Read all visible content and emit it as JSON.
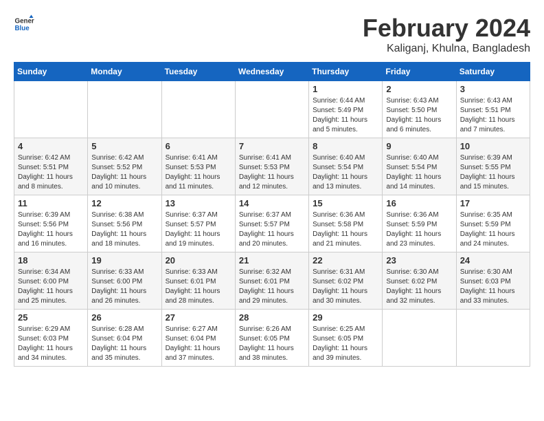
{
  "header": {
    "title": "February 2024",
    "location": "Kaliganj, Khulna, Bangladesh",
    "logo_general": "General",
    "logo_blue": "Blue"
  },
  "weekdays": [
    "Sunday",
    "Monday",
    "Tuesday",
    "Wednesday",
    "Thursday",
    "Friday",
    "Saturday"
  ],
  "weeks": [
    [
      {
        "day": "",
        "info": ""
      },
      {
        "day": "",
        "info": ""
      },
      {
        "day": "",
        "info": ""
      },
      {
        "day": "",
        "info": ""
      },
      {
        "day": "1",
        "info": "Sunrise: 6:44 AM\nSunset: 5:49 PM\nDaylight: 11 hours\nand 5 minutes."
      },
      {
        "day": "2",
        "info": "Sunrise: 6:43 AM\nSunset: 5:50 PM\nDaylight: 11 hours\nand 6 minutes."
      },
      {
        "day": "3",
        "info": "Sunrise: 6:43 AM\nSunset: 5:51 PM\nDaylight: 11 hours\nand 7 minutes."
      }
    ],
    [
      {
        "day": "4",
        "info": "Sunrise: 6:42 AM\nSunset: 5:51 PM\nDaylight: 11 hours\nand 8 minutes."
      },
      {
        "day": "5",
        "info": "Sunrise: 6:42 AM\nSunset: 5:52 PM\nDaylight: 11 hours\nand 10 minutes."
      },
      {
        "day": "6",
        "info": "Sunrise: 6:41 AM\nSunset: 5:53 PM\nDaylight: 11 hours\nand 11 minutes."
      },
      {
        "day": "7",
        "info": "Sunrise: 6:41 AM\nSunset: 5:53 PM\nDaylight: 11 hours\nand 12 minutes."
      },
      {
        "day": "8",
        "info": "Sunrise: 6:40 AM\nSunset: 5:54 PM\nDaylight: 11 hours\nand 13 minutes."
      },
      {
        "day": "9",
        "info": "Sunrise: 6:40 AM\nSunset: 5:54 PM\nDaylight: 11 hours\nand 14 minutes."
      },
      {
        "day": "10",
        "info": "Sunrise: 6:39 AM\nSunset: 5:55 PM\nDaylight: 11 hours\nand 15 minutes."
      }
    ],
    [
      {
        "day": "11",
        "info": "Sunrise: 6:39 AM\nSunset: 5:56 PM\nDaylight: 11 hours\nand 16 minutes."
      },
      {
        "day": "12",
        "info": "Sunrise: 6:38 AM\nSunset: 5:56 PM\nDaylight: 11 hours\nand 18 minutes."
      },
      {
        "day": "13",
        "info": "Sunrise: 6:37 AM\nSunset: 5:57 PM\nDaylight: 11 hours\nand 19 minutes."
      },
      {
        "day": "14",
        "info": "Sunrise: 6:37 AM\nSunset: 5:57 PM\nDaylight: 11 hours\nand 20 minutes."
      },
      {
        "day": "15",
        "info": "Sunrise: 6:36 AM\nSunset: 5:58 PM\nDaylight: 11 hours\nand 21 minutes."
      },
      {
        "day": "16",
        "info": "Sunrise: 6:36 AM\nSunset: 5:59 PM\nDaylight: 11 hours\nand 23 minutes."
      },
      {
        "day": "17",
        "info": "Sunrise: 6:35 AM\nSunset: 5:59 PM\nDaylight: 11 hours\nand 24 minutes."
      }
    ],
    [
      {
        "day": "18",
        "info": "Sunrise: 6:34 AM\nSunset: 6:00 PM\nDaylight: 11 hours\nand 25 minutes."
      },
      {
        "day": "19",
        "info": "Sunrise: 6:33 AM\nSunset: 6:00 PM\nDaylight: 11 hours\nand 26 minutes."
      },
      {
        "day": "20",
        "info": "Sunrise: 6:33 AM\nSunset: 6:01 PM\nDaylight: 11 hours\nand 28 minutes."
      },
      {
        "day": "21",
        "info": "Sunrise: 6:32 AM\nSunset: 6:01 PM\nDaylight: 11 hours\nand 29 minutes."
      },
      {
        "day": "22",
        "info": "Sunrise: 6:31 AM\nSunset: 6:02 PM\nDaylight: 11 hours\nand 30 minutes."
      },
      {
        "day": "23",
        "info": "Sunrise: 6:30 AM\nSunset: 6:02 PM\nDaylight: 11 hours\nand 32 minutes."
      },
      {
        "day": "24",
        "info": "Sunrise: 6:30 AM\nSunset: 6:03 PM\nDaylight: 11 hours\nand 33 minutes."
      }
    ],
    [
      {
        "day": "25",
        "info": "Sunrise: 6:29 AM\nSunset: 6:03 PM\nDaylight: 11 hours\nand 34 minutes."
      },
      {
        "day": "26",
        "info": "Sunrise: 6:28 AM\nSunset: 6:04 PM\nDaylight: 11 hours\nand 35 minutes."
      },
      {
        "day": "27",
        "info": "Sunrise: 6:27 AM\nSunset: 6:04 PM\nDaylight: 11 hours\nand 37 minutes."
      },
      {
        "day": "28",
        "info": "Sunrise: 6:26 AM\nSunset: 6:05 PM\nDaylight: 11 hours\nand 38 minutes."
      },
      {
        "day": "29",
        "info": "Sunrise: 6:25 AM\nSunset: 6:05 PM\nDaylight: 11 hours\nand 39 minutes."
      },
      {
        "day": "",
        "info": ""
      },
      {
        "day": "",
        "info": ""
      }
    ]
  ]
}
